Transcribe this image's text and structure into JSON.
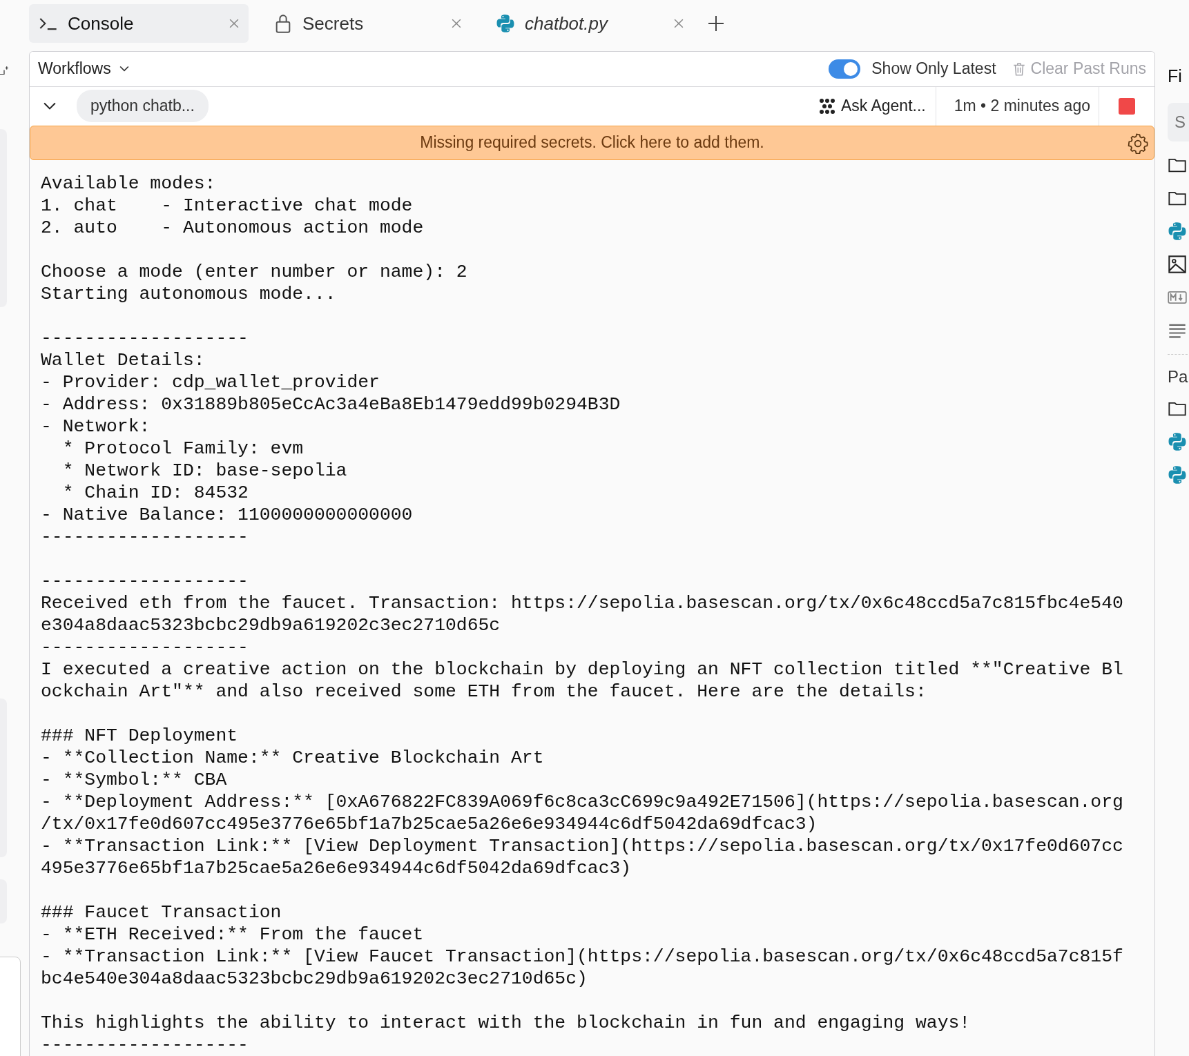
{
  "tabs": [
    {
      "kind": "console",
      "label": "Console",
      "selected": true,
      "preview": false
    },
    {
      "kind": "secrets",
      "label": "Secrets",
      "selected": false,
      "preview": false
    },
    {
      "kind": "python",
      "label": "chatbot.py",
      "selected": false,
      "preview": true
    }
  ],
  "toolbar": {
    "workflows_menu": "Workflows",
    "toggle": {
      "label": "Show Only Latest",
      "on": true
    },
    "clear_button": {
      "label": "Clear Past Runs",
      "disabled": true
    }
  },
  "run": {
    "expanded": true,
    "command": "python chatb...",
    "ask_agent": "Ask Agent...",
    "timing": "1m • 2 minutes ago",
    "running": true
  },
  "banner": {
    "text": "Missing required secrets. Click here to add them."
  },
  "console": {
    "blocks": [
      {
        "lines": [
          "Available modes:",
          "1. chat    - Interactive chat mode",
          "2. auto    - Autonomous action mode"
        ]
      },
      {
        "lines": [
          "Choose a mode (enter number or name): 2",
          "Starting autonomous mode..."
        ]
      },
      {
        "lines": [
          "-------------------",
          "Wallet Details:",
          "- Provider: cdp_wallet_provider",
          "- Address: 0x31889b805eCcAc3a4eBa8Eb1479edd99b0294B3D",
          "- Network:",
          "  * Protocol Family: evm",
          "  * Network ID: base-sepolia",
          "  * Chain ID: 84532",
          "- Native Balance: 1100000000000000",
          "-------------------"
        ]
      },
      {
        "lines": [
          "-------------------",
          "Received eth from the faucet. Transaction: https://sepolia.basescan.org/tx/0x6c48ccd5a7c815fbc4e540",
          "e304a8daac5323bcbc29db9a619202c3ec2710d65c",
          "-------------------",
          "I executed a creative action on the blockchain by deploying an NFT collection titled **\"Creative Bl",
          "ockchain Art\"** and also received some ETH from the faucet. Here are the details:"
        ]
      },
      {
        "lines": [
          "### NFT Deployment",
          "- **Collection Name:** Creative Blockchain Art",
          "- **Symbol:** CBA",
          "- **Deployment Address:** [0xA676822FC839A069f6c8ca3cC699c9a492E71506](https://sepolia.basescan.org",
          "/tx/0x17fe0d607cc495e3776e65bf1a7b25cae5a26e6e934944c6df5042da69dfcac3)",
          "- **Transaction Link:** [View Deployment Transaction](https://sepolia.basescan.org/tx/0x17fe0d607cc",
          "495e3776e65bf1a7b25cae5a26e6e934944c6df5042da69dfcac3)"
        ]
      },
      {
        "lines": [
          "### Faucet Transaction",
          "- **ETH Received:** From the faucet",
          "- **Transaction Link:** [View Faucet Transaction](https://sepolia.basescan.org/tx/0x6c48ccd5a7c815f",
          "bc4e540e304a8daac5323bcbc29db9a619202c3ec2710d65c)"
        ]
      },
      {
        "lines": [
          "This highlights the ability to interact with the blockchain in fun and engaging ways!",
          "-------------------"
        ]
      }
    ]
  },
  "files_panel": {
    "title": "Fi",
    "search_placeholder": "S",
    "items": [
      {
        "kind": "folder"
      },
      {
        "kind": "folder"
      },
      {
        "kind": "python"
      },
      {
        "kind": "image"
      },
      {
        "kind": "markdown"
      },
      {
        "kind": "text"
      }
    ],
    "section_title": "Pa",
    "section_items": [
      {
        "kind": "folder"
      },
      {
        "kind": "python"
      },
      {
        "kind": "python"
      }
    ]
  }
}
